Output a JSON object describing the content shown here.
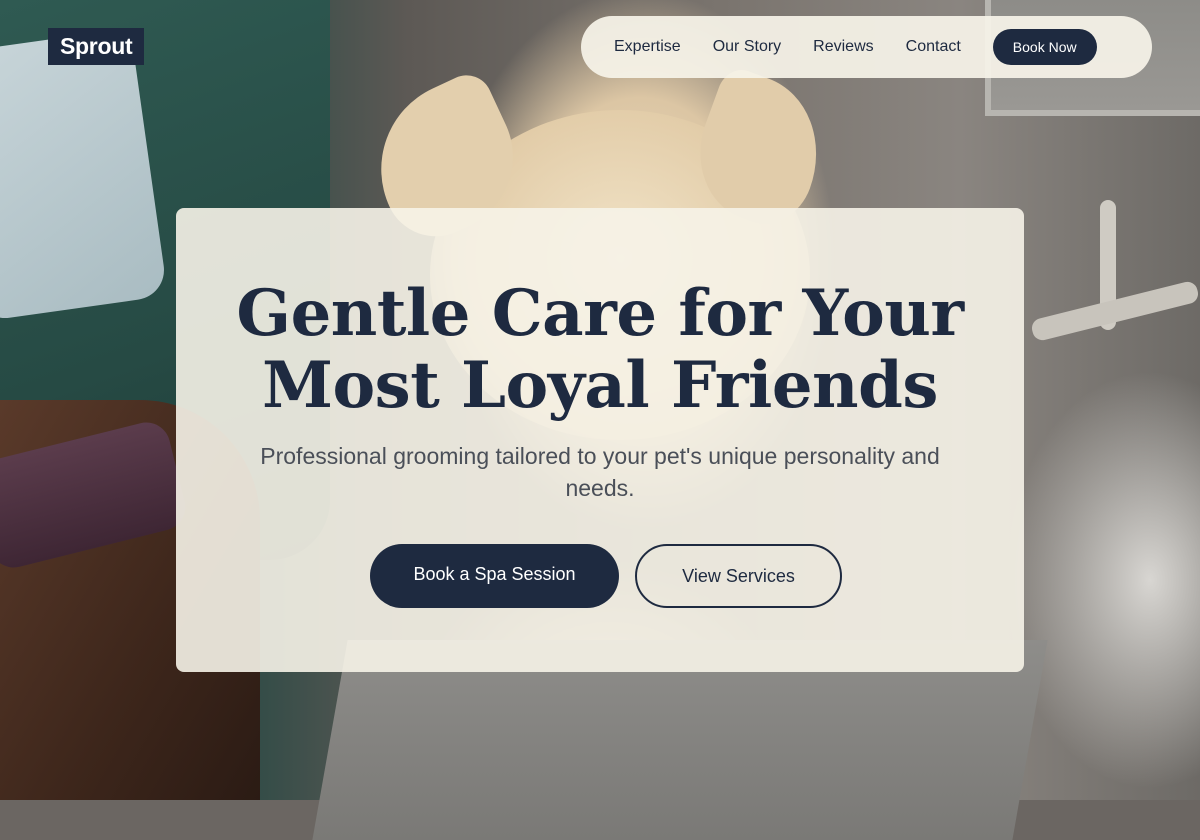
{
  "brand": {
    "name": "Sprout"
  },
  "nav": {
    "links": [
      "Expertise",
      "Our Story",
      "Reviews",
      "Contact"
    ],
    "cta_label": "Book Now"
  },
  "hero": {
    "title_line1": "Gentle Care for Your",
    "title_line2": "Most Loyal Friends",
    "subtitle": "Professional grooming tailored to your pet's unique personality and needs.",
    "primary_cta": "Book a Spa Session",
    "secondary_cta": "View Services"
  },
  "colors": {
    "primary": "#1e2a40",
    "card_background": "#f6f3e8",
    "subtitle_text": "#4a4f58"
  }
}
